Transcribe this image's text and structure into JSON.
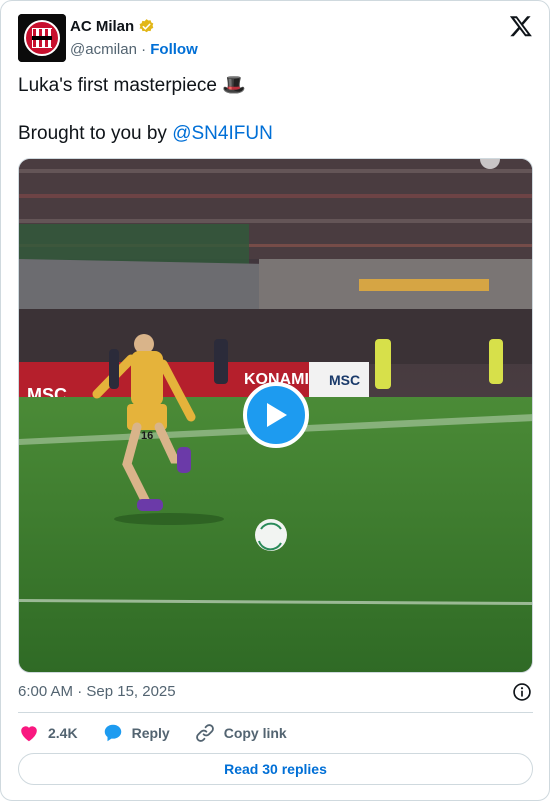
{
  "author": {
    "name": "AC Milan",
    "handle": "@acmilan",
    "separator": "·",
    "follow_label": "Follow",
    "verified_color": "#e2b719",
    "avatar_lettering": "ACM 1899"
  },
  "tweet": {
    "line1": "Luka's first masterpiece",
    "emoji": "🎩",
    "line2_prefix": "Brought to you by",
    "mention": "@SN4IFUN"
  },
  "media": {
    "type": "video",
    "board_text_left": "MSC",
    "board_text_right": "KONAMI",
    "board_text_far_right": "MSC",
    "shirt_number": "16",
    "play_icon": "play-icon"
  },
  "timestamp": "6:00 AM · Sep 15, 2025",
  "actions": {
    "like_count": "2.4K",
    "reply_label": "Reply",
    "copy_label": "Copy link"
  },
  "read_replies_label": "Read 30 replies",
  "colors": {
    "accent": "#006fd6",
    "play_button": "#1d9bf0",
    "like": "#f91880",
    "reply_icon": "#1d9bf0",
    "pitch": "#3c7a2e",
    "kit": "#e5b33b"
  }
}
